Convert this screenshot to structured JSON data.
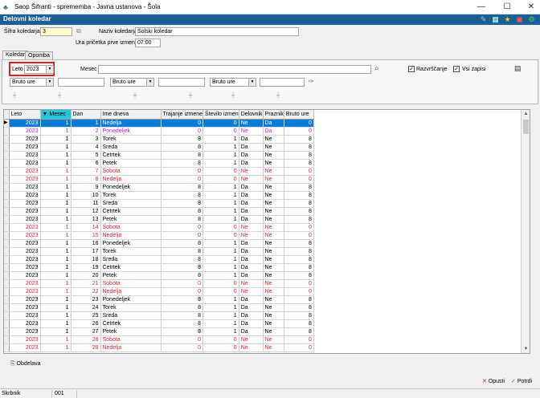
{
  "window": {
    "title": "Saop  Šifranti - sprememba - Javna ustanova - Šola",
    "minimize": "—",
    "maximize": "☐",
    "close": "✕"
  },
  "header": {
    "title": "Delovni koledar"
  },
  "form": {
    "sifra_label": "Šifra koledarja",
    "sifra_value": "3",
    "naziv_label": "Naziv koledarja",
    "naziv_value": "Šolski koledar",
    "ura_label": "Ura pričetka prve izmene",
    "ura_value": "07:00"
  },
  "tabs": [
    {
      "label": "Koledar",
      "active": true
    },
    {
      "label": "Opomba",
      "active": false
    }
  ],
  "filters": {
    "leto_label": "Leto",
    "leto_value": "2023",
    "mesec_label": "Mesec",
    "mesec_value": "",
    "razvrscanje_label": "Razvrščanje",
    "vsi_zapisi_label": "Vsi zapisi",
    "razvrscanje_checked": "✓",
    "vsi_zapisi_checked": "✓",
    "bruto1": "Bruto ure",
    "bruto2": "Bruto ure",
    "bruto3": "Bruto ure"
  },
  "columns": [
    "Leto",
    "Mesec",
    "Dan",
    "Ime dneva",
    "Trajanje izmene",
    "Število izmen",
    "Delovnik",
    "Praznik",
    "Bruto ure"
  ],
  "rows": [
    {
      "leto": "2023",
      "mesec": "1",
      "dan": "1",
      "ime": "Nedelja",
      "trajanje": "0",
      "stevilo": "0",
      "delovnik": "Ne",
      "praznik": "Da",
      "bruto": "0",
      "style": "sel"
    },
    {
      "leto": "2023",
      "mesec": "1",
      "dan": "2",
      "ime": "Ponedeljek",
      "trajanje": "0",
      "stevilo": "0",
      "delovnik": "Ne",
      "praznik": "Da",
      "bruto": "0",
      "style": "magenta"
    },
    {
      "leto": "2023",
      "mesec": "1",
      "dan": "3",
      "ime": "Torek",
      "trajanje": "8",
      "stevilo": "1",
      "delovnik": "Da",
      "praznik": "Ne",
      "bruto": "8",
      "style": ""
    },
    {
      "leto": "2023",
      "mesec": "1",
      "dan": "4",
      "ime": "Sreda",
      "trajanje": "8",
      "stevilo": "1",
      "delovnik": "Da",
      "praznik": "Ne",
      "bruto": "8",
      "style": ""
    },
    {
      "leto": "2023",
      "mesec": "1",
      "dan": "5",
      "ime": "Četrtek",
      "trajanje": "8",
      "stevilo": "1",
      "delovnik": "Da",
      "praznik": "Ne",
      "bruto": "8",
      "style": ""
    },
    {
      "leto": "2023",
      "mesec": "1",
      "dan": "6",
      "ime": "Petek",
      "trajanje": "8",
      "stevilo": "1",
      "delovnik": "Da",
      "praznik": "Ne",
      "bruto": "8",
      "style": ""
    },
    {
      "leto": "2023",
      "mesec": "1",
      "dan": "7",
      "ime": "Sobota",
      "trajanje": "0",
      "stevilo": "0",
      "delovnik": "Ne",
      "praznik": "Ne",
      "bruto": "0",
      "style": "red"
    },
    {
      "leto": "2023",
      "mesec": "1",
      "dan": "8",
      "ime": "Nedelja",
      "trajanje": "0",
      "stevilo": "0",
      "delovnik": "Ne",
      "praznik": "Ne",
      "bruto": "0",
      "style": "red"
    },
    {
      "leto": "2023",
      "mesec": "1",
      "dan": "9",
      "ime": "Ponedeljek",
      "trajanje": "8",
      "stevilo": "1",
      "delovnik": "Da",
      "praznik": "Ne",
      "bruto": "8",
      "style": ""
    },
    {
      "leto": "2023",
      "mesec": "1",
      "dan": "10",
      "ime": "Torek",
      "trajanje": "8",
      "stevilo": "1",
      "delovnik": "Da",
      "praznik": "Ne",
      "bruto": "8",
      "style": ""
    },
    {
      "leto": "2023",
      "mesec": "1",
      "dan": "11",
      "ime": "Sreda",
      "trajanje": "8",
      "stevilo": "1",
      "delovnik": "Da",
      "praznik": "Ne",
      "bruto": "8",
      "style": ""
    },
    {
      "leto": "2023",
      "mesec": "1",
      "dan": "12",
      "ime": "Četrtek",
      "trajanje": "8",
      "stevilo": "1",
      "delovnik": "Da",
      "praznik": "Ne",
      "bruto": "8",
      "style": ""
    },
    {
      "leto": "2023",
      "mesec": "1",
      "dan": "13",
      "ime": "Petek",
      "trajanje": "8",
      "stevilo": "1",
      "delovnik": "Da",
      "praznik": "Ne",
      "bruto": "8",
      "style": ""
    },
    {
      "leto": "2023",
      "mesec": "1",
      "dan": "14",
      "ime": "Sobota",
      "trajanje": "0",
      "stevilo": "0",
      "delovnik": "Ne",
      "praznik": "Ne",
      "bruto": "0",
      "style": "red"
    },
    {
      "leto": "2023",
      "mesec": "1",
      "dan": "15",
      "ime": "Nedelja",
      "trajanje": "0",
      "stevilo": "0",
      "delovnik": "Ne",
      "praznik": "Ne",
      "bruto": "0",
      "style": "red"
    },
    {
      "leto": "2023",
      "mesec": "1",
      "dan": "16",
      "ime": "Ponedeljek",
      "trajanje": "8",
      "stevilo": "1",
      "delovnik": "Da",
      "praznik": "Ne",
      "bruto": "8",
      "style": ""
    },
    {
      "leto": "2023",
      "mesec": "1",
      "dan": "17",
      "ime": "Torek",
      "trajanje": "8",
      "stevilo": "1",
      "delovnik": "Da",
      "praznik": "Ne",
      "bruto": "8",
      "style": ""
    },
    {
      "leto": "2023",
      "mesec": "1",
      "dan": "18",
      "ime": "Sreda",
      "trajanje": "8",
      "stevilo": "1",
      "delovnik": "Da",
      "praznik": "Ne",
      "bruto": "8",
      "style": ""
    },
    {
      "leto": "2023",
      "mesec": "1",
      "dan": "19",
      "ime": "Četrtek",
      "trajanje": "8",
      "stevilo": "1",
      "delovnik": "Da",
      "praznik": "Ne",
      "bruto": "8",
      "style": ""
    },
    {
      "leto": "2023",
      "mesec": "1",
      "dan": "20",
      "ime": "Petek",
      "trajanje": "8",
      "stevilo": "1",
      "delovnik": "Da",
      "praznik": "Ne",
      "bruto": "8",
      "style": ""
    },
    {
      "leto": "2023",
      "mesec": "1",
      "dan": "21",
      "ime": "Sobota",
      "trajanje": "0",
      "stevilo": "0",
      "delovnik": "Ne",
      "praznik": "Ne",
      "bruto": "0",
      "style": "red"
    },
    {
      "leto": "2023",
      "mesec": "1",
      "dan": "22",
      "ime": "Nedelja",
      "trajanje": "0",
      "stevilo": "0",
      "delovnik": "Ne",
      "praznik": "Ne",
      "bruto": "0",
      "style": "red"
    },
    {
      "leto": "2023",
      "mesec": "1",
      "dan": "23",
      "ime": "Ponedeljek",
      "trajanje": "8",
      "stevilo": "1",
      "delovnik": "Da",
      "praznik": "Ne",
      "bruto": "8",
      "style": ""
    },
    {
      "leto": "2023",
      "mesec": "1",
      "dan": "24",
      "ime": "Torek",
      "trajanje": "8",
      "stevilo": "1",
      "delovnik": "Da",
      "praznik": "Ne",
      "bruto": "8",
      "style": ""
    },
    {
      "leto": "2023",
      "mesec": "1",
      "dan": "25",
      "ime": "Sreda",
      "trajanje": "8",
      "stevilo": "1",
      "delovnik": "Da",
      "praznik": "Ne",
      "bruto": "8",
      "style": ""
    },
    {
      "leto": "2023",
      "mesec": "1",
      "dan": "26",
      "ime": "Četrtek",
      "trajanje": "8",
      "stevilo": "1",
      "delovnik": "Da",
      "praznik": "Ne",
      "bruto": "8",
      "style": ""
    },
    {
      "leto": "2023",
      "mesec": "1",
      "dan": "27",
      "ime": "Petek",
      "trajanje": "8",
      "stevilo": "1",
      "delovnik": "Da",
      "praznik": "Ne",
      "bruto": "8",
      "style": ""
    },
    {
      "leto": "2023",
      "mesec": "1",
      "dan": "28",
      "ime": "Sobota",
      "trajanje": "0",
      "stevilo": "0",
      "delovnik": "Ne",
      "praznik": "Ne",
      "bruto": "0",
      "style": "red"
    },
    {
      "leto": "2023",
      "mesec": "1",
      "dan": "29",
      "ime": "Nedelja",
      "trajanje": "0",
      "stevilo": "0",
      "delovnik": "Ne",
      "praznik": "Ne",
      "bruto": "0",
      "style": "red"
    }
  ],
  "buttons": {
    "obdelava": "Obdelava",
    "opusti": "Opusti",
    "potrdi": "Potrdi"
  },
  "status": {
    "user": "Skrbnik",
    "code": "001"
  },
  "colors": {
    "header_bg": "#1c5f94",
    "selection": "#0a7bd6",
    "weekend": "#e8203a",
    "holiday": "#d020d0",
    "sorted_col": "#26c6da"
  }
}
